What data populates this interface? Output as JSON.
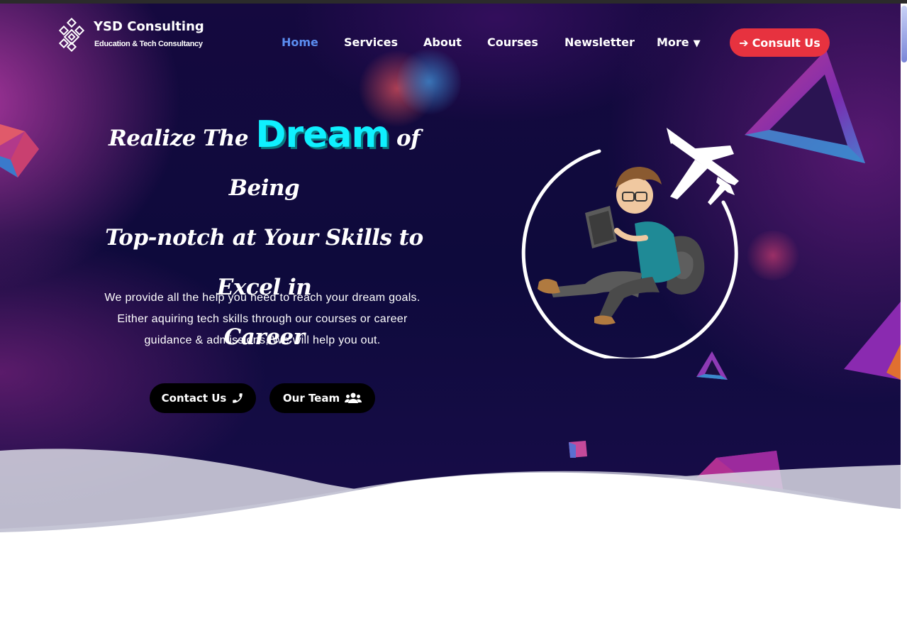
{
  "brand": {
    "name": "YSD Consulting",
    "tagline": "Education & Tech Consultancy",
    "logo_icon": "diamond-grid-logo"
  },
  "nav": {
    "items": [
      {
        "label": "Home",
        "active": true
      },
      {
        "label": "Services",
        "active": false
      },
      {
        "label": "About",
        "active": false
      },
      {
        "label": "Courses",
        "active": false
      },
      {
        "label": "Newsletter",
        "active": false
      },
      {
        "label": "More",
        "active": false,
        "icon": "caret-down-icon"
      }
    ],
    "consult_label": "Consult Us",
    "consult_icon": "arrow-right-icon"
  },
  "hero": {
    "headline_pre": "Realize The",
    "headline_highlight": "Dream",
    "headline_post": "of Being",
    "headline_line2": "Top-notch at Your Skills to Excel in",
    "headline_line3": "Career",
    "description_line1": "We provide all the help you need to reach your dream goals.",
    "description_line2": "Either aquiring tech skills through our courses or career",
    "description_line3": "guidance & admissions, We will help you out.",
    "contact_label": "Contact Us",
    "contact_icon": "phone-icon",
    "team_label": "Our Team",
    "team_icon": "users-icon"
  },
  "colors": {
    "accent": "#e7323f",
    "highlight": "#0ff0ff",
    "active_nav": "#5b8df0",
    "hero_bg": "#0e0a3c"
  }
}
